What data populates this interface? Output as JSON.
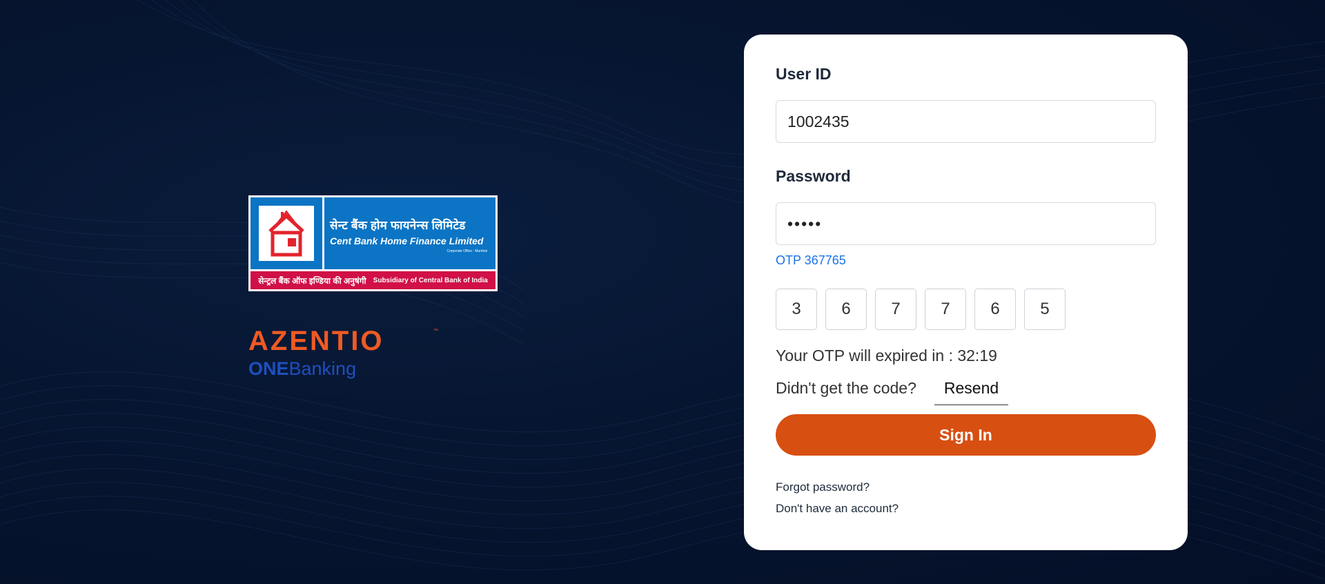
{
  "brand": {
    "logo_hindi": "सेन्ट बैंक होम फायनेन्स लिमिटेड",
    "logo_english": "Cent Bank Home Finance Limited",
    "logo_office": "Corporate Office : Mumbai",
    "logo_bottom_hindi": "सेन्ट्रल बैंक ऑफ इण्डिया की अनुषंगी",
    "logo_bottom_english": "Subsidiary of Central Bank of India",
    "azentio": "AZENTIO",
    "azentio_tm": "™",
    "one": "ONE",
    "banking": "Banking"
  },
  "login": {
    "user_id_label": "User ID",
    "user_id_value": "1002435",
    "password_label": "Password",
    "password_value": "12345",
    "otp_hint": "OTP 367765",
    "otp_digits": [
      "3",
      "6",
      "7",
      "7",
      "6",
      "5"
    ],
    "expiry_text": "Your OTP will expired in : 32:19",
    "resend_prompt": "Didn't get the code?",
    "resend_label": "Resend",
    "signin_label": "Sign In",
    "forgot_label": "Forgot password?",
    "signup_label": "Don't have an account?"
  },
  "colors": {
    "background": "#061530",
    "accent": "#d84f12",
    "link": "#1a73e8",
    "azentio_orange": "#f05a22",
    "onebanking_blue": "#1f4fbf",
    "logo_blue": "#0b74c4",
    "logo_red": "#d01047"
  }
}
